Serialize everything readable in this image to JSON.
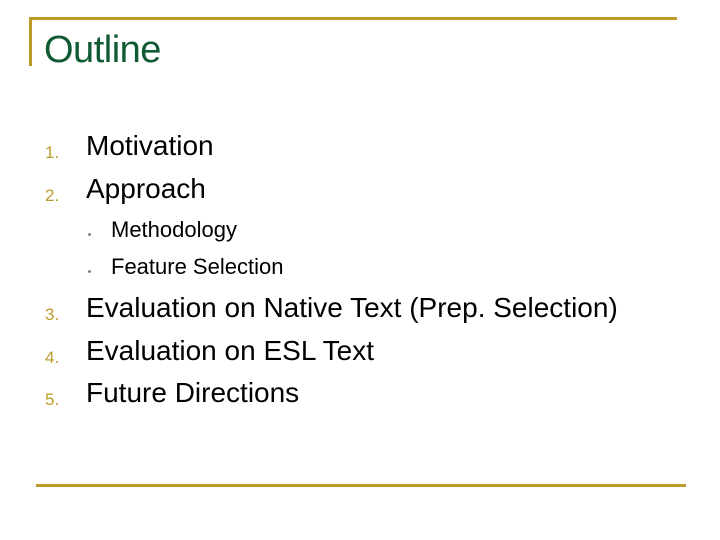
{
  "slide": {
    "title": "Outline",
    "accent_color": "#BC9A2A",
    "title_color": "#0F5A32",
    "items": [
      {
        "number": "1.",
        "label": "Motivation"
      },
      {
        "number": "2.",
        "label": "Approach",
        "subitems": [
          {
            "bullet": "•",
            "label": "Methodology"
          },
          {
            "bullet": "•",
            "label": "Feature Selection"
          }
        ]
      },
      {
        "number": "3.",
        "label": "Evaluation on Native Text (Prep. Selection)"
      },
      {
        "number": "4.",
        "label": "Evaluation on ESL Text"
      },
      {
        "number": "5.",
        "label": "Future Directions"
      }
    ]
  }
}
